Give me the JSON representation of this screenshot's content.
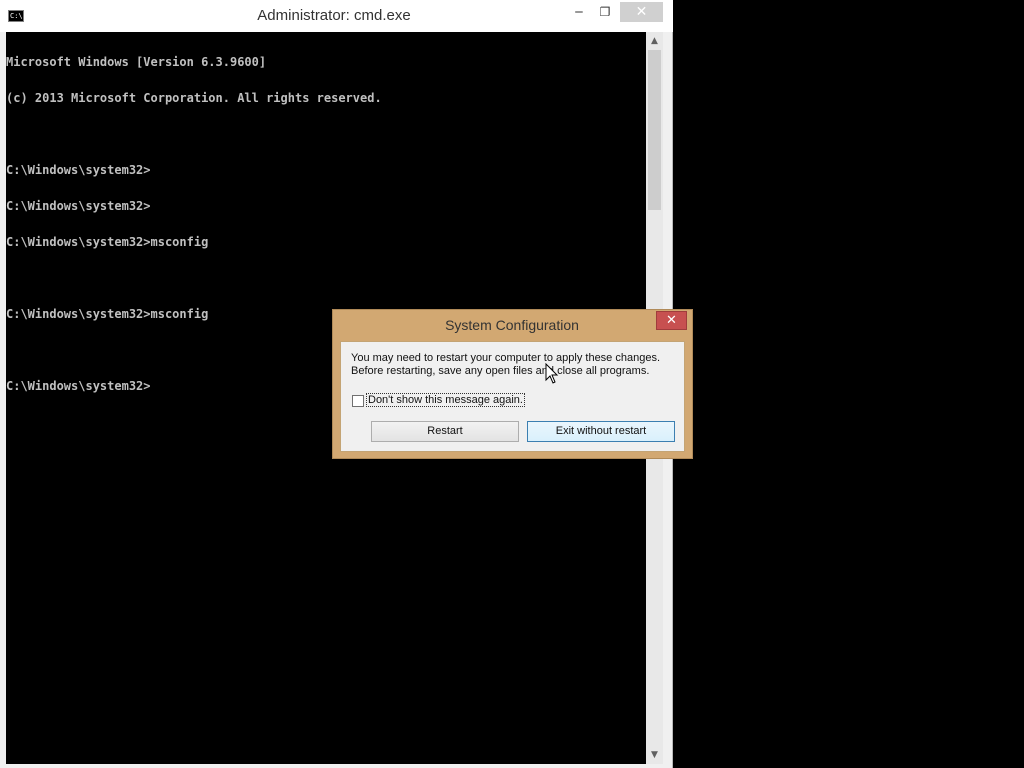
{
  "cmd": {
    "title": "Administrator: cmd.exe",
    "icon": "cmd-icon",
    "icon_text": "C:\\",
    "controls": {
      "minimize": "‒",
      "maximize": "❐",
      "close": "✕"
    },
    "lines": [
      "Microsoft Windows [Version 6.3.9600]",
      "(c) 2013 Microsoft Corporation. All rights reserved.",
      "",
      "C:\\Windows\\system32>",
      "C:\\Windows\\system32>",
      "C:\\Windows\\system32>msconfig",
      "",
      "C:\\Windows\\system32>msconfig",
      "",
      "C:\\Windows\\system32>"
    ],
    "scroll": {
      "up": "▲",
      "down": "▼"
    }
  },
  "dialog": {
    "title": "System Configuration",
    "close": "✕",
    "message_line1": "You may need to restart your computer to apply these changes.",
    "message_line2": "Before restarting, save any open files and close all programs.",
    "checkbox_label": "Don't show this message again.",
    "checkbox_checked": false,
    "restart_label": "Restart",
    "exit_label": "Exit without restart"
  },
  "colors": {
    "console_bg": "#000000",
    "console_text": "#c0c0c0",
    "dialog_frame": "#d2a872",
    "close_red": "#c75050"
  }
}
